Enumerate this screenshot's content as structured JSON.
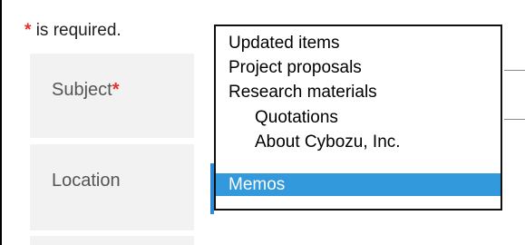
{
  "required_note": {
    "star": "*",
    "text": "is required."
  },
  "fields": {
    "subject": {
      "label": "Subject",
      "star": "*"
    },
    "location": {
      "label": "Location"
    }
  },
  "dropdown": {
    "options": [
      {
        "label": "Updated items",
        "level": 0,
        "selected": false
      },
      {
        "label": "Project proposals",
        "level": 0,
        "selected": false
      },
      {
        "label": "Research materials",
        "level": 0,
        "selected": false
      },
      {
        "label": "Quotations",
        "level": 1,
        "selected": false
      },
      {
        "label": "About Cybozu, Inc.",
        "level": 1,
        "selected": false
      },
      {
        "label": "Memos",
        "level": 0,
        "selected": true
      }
    ]
  },
  "colors": {
    "required_star": "#e8302a",
    "selection": "#3399dd",
    "label_cell": "#f2f2f2"
  }
}
